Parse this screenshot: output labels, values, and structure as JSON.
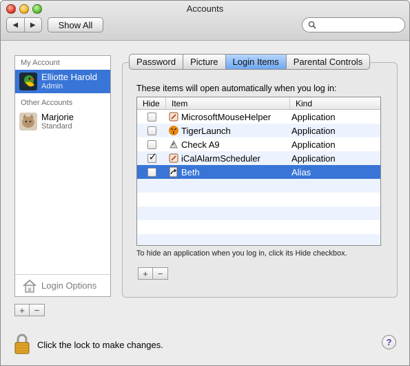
{
  "window": {
    "title": "Accounts"
  },
  "toolbar": {
    "back_icon": "◀",
    "forward_icon": "▶",
    "show_all_label": "Show All",
    "search_value": ""
  },
  "sidebar": {
    "my_account_header": "My Account",
    "my_account": {
      "name": "Elliotte Harold",
      "role": "Admin"
    },
    "other_accounts_header": "Other Accounts",
    "other_accounts": [
      {
        "name": "Marjorie",
        "role": "Standard"
      }
    ],
    "login_options_label": "Login Options",
    "add_label": "+",
    "remove_label": "−"
  },
  "tabs": [
    {
      "label": "Password"
    },
    {
      "label": "Picture"
    },
    {
      "label": "Login Items",
      "active": true
    },
    {
      "label": "Parental Controls"
    }
  ],
  "login_items": {
    "description": "These items will open automatically when you log in:",
    "columns": {
      "hide": "Hide",
      "item": "Item",
      "kind": "Kind"
    },
    "rows": [
      {
        "hide": false,
        "item": "MicrosoftMouseHelper",
        "kind": "Application",
        "icon": "app-icon",
        "selected": false
      },
      {
        "hide": false,
        "item": "TigerLaunch",
        "kind": "Application",
        "icon": "tiger-icon",
        "selected": false
      },
      {
        "hide": false,
        "item": "Check A9",
        "kind": "Application",
        "icon": "app-icon",
        "selected": false
      },
      {
        "hide": true,
        "item": "iCalAlarmScheduler",
        "kind": "Application",
        "icon": "app-icon",
        "selected": false
      },
      {
        "hide": false,
        "item": "Beth",
        "kind": "Alias",
        "icon": "alias-icon",
        "selected": true
      }
    ],
    "hint": "To hide an application when you log in, click its Hide checkbox.",
    "add_label": "+",
    "remove_label": "−"
  },
  "footer": {
    "lock_text": "Click the lock to make changes.",
    "help_label": "?"
  },
  "colors": {
    "selection": "#3875d7",
    "active_tab": "#6ea7ef",
    "stripe": "#edf3fe"
  }
}
